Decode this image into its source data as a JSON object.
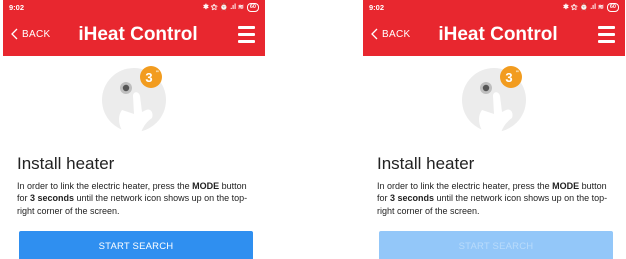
{
  "status": {
    "time": "9:02",
    "icons": "✱ ⚝ ⏰ .ıl ≋",
    "battery": "60"
  },
  "header": {
    "back_label": "BACK",
    "title": "iHeat Control"
  },
  "badge": {
    "value": "3",
    "unit": "\""
  },
  "content": {
    "heading": "Install heater",
    "desc_1": "In order to link the electric heater, press the ",
    "desc_mode": "MODE",
    "desc_2": " button for ",
    "desc_secs": "3 seconds",
    "desc_3": " until the network icon shows up on the top-right corner of the screen."
  },
  "screens": [
    {
      "button_label": "START SEARCH",
      "button_state": "enabled"
    },
    {
      "button_label": "START SEARCH",
      "button_state": "disabled"
    }
  ],
  "colors": {
    "brand_red": "#e8272f",
    "button_blue": "#2f8ff0",
    "button_disabled": "#93c7f9",
    "badge_orange": "#f29c1f"
  }
}
